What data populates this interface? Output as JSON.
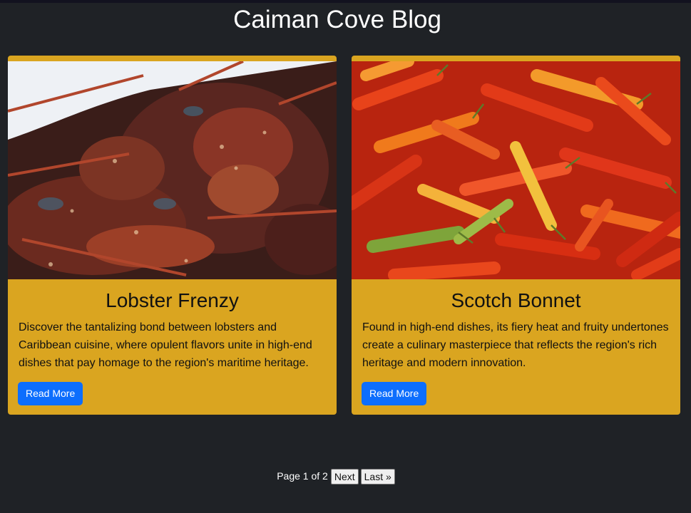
{
  "site": {
    "title": "Caiman Cove Blog"
  },
  "posts": [
    {
      "title": "Lobster Frenzy",
      "text": "Discover the tantalizing bond between lobsters and Caribbean cuisine, where opulent flavors unite in high-end dishes that pay homage to the region's maritime heritage.",
      "button_label": "Read More",
      "image": "photo of spiny lobsters"
    },
    {
      "title": "Scotch Bonnet",
      "text": "Found in high-end dishes, its fiery heat and fruity undertones create a culinary masterpiece that reflects the region's rich heritage and modern innovation.",
      "button_label": "Read More",
      "image": "photo of red, orange and green chili peppers"
    }
  ],
  "pagination": {
    "info": "Page 1 of 2",
    "next_label": "Next",
    "last_label": "Last »"
  },
  "colors": {
    "background": "#1f2226",
    "card": "#daa520",
    "button": "#0d6efd"
  }
}
